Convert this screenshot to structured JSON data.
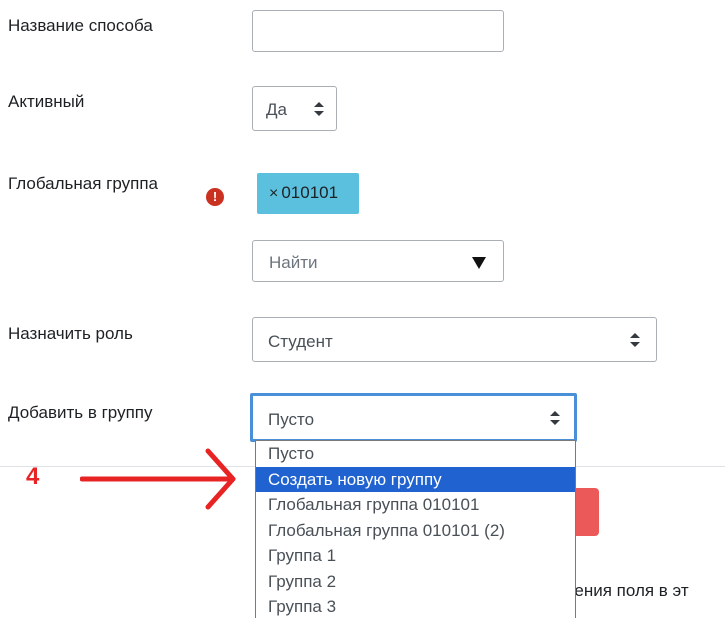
{
  "form": {
    "method_name": {
      "label": "Название способа",
      "value": ""
    },
    "active": {
      "label": "Активный",
      "value": "Да"
    },
    "global_group": {
      "label": "Глобальная группа",
      "tag": "010101",
      "tag_remove": "×",
      "error_symbol": "!",
      "search_placeholder": "Найти"
    },
    "assign_role": {
      "label": "Назначить роль",
      "value": "Студент"
    },
    "add_to_group": {
      "label": "Добавить в группу",
      "value": "Пусто",
      "options": [
        "Пусто",
        "Создать новую группу",
        "Глобальная группа 010101",
        "Глобальная группа 010101 (2)",
        "Группа 1",
        "Группа 2",
        "Группа 3"
      ],
      "highlighted_index": 1
    }
  },
  "annotation": {
    "step_number": "4",
    "color": "#e82323"
  },
  "background_text": "нения поля в эт",
  "colors": {
    "tag_bg": "#5bc0de",
    "focus_border": "#4a90d9",
    "highlight": "#1f62d0",
    "error": "#ca3120",
    "danger_button": "#ec5959"
  },
  "icons": {
    "select_arrows": "up-down-caret-icon",
    "dropdown_triangle": "triangle-down-icon",
    "error": "exclamation-circle-icon",
    "arrow": "red-arrow-icon"
  }
}
